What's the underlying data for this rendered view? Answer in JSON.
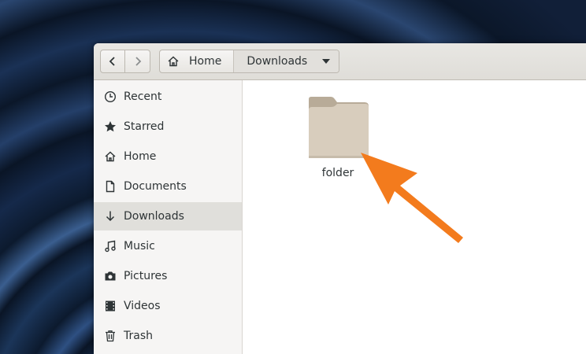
{
  "header": {
    "back_icon": "chevron-left-icon",
    "forward_icon": "chevron-right-icon",
    "path": [
      "Home",
      "Downloads"
    ],
    "dropdown_icon": "caret-down-icon"
  },
  "sidebar": {
    "items": [
      {
        "label": "Recent",
        "icon": "clock-icon"
      },
      {
        "label": "Starred",
        "icon": "star-icon"
      },
      {
        "label": "Home",
        "icon": "home-icon"
      },
      {
        "label": "Documents",
        "icon": "document-icon"
      },
      {
        "label": "Downloads",
        "icon": "download-icon",
        "selected": true
      },
      {
        "label": "Music",
        "icon": "music-icon"
      },
      {
        "label": "Pictures",
        "icon": "camera-icon"
      },
      {
        "label": "Videos",
        "icon": "film-icon"
      },
      {
        "label": "Trash",
        "icon": "trash-icon"
      }
    ]
  },
  "content": {
    "items": [
      {
        "name": "folder",
        "icon": "folder-icon"
      }
    ]
  },
  "annotation": {
    "arrow_color": "#f37b1d",
    "icon": "arrow-annotation-icon"
  },
  "colors": {
    "selected_bg": "#e0dfdb",
    "folder_body": "#d8cdbd",
    "folder_tab": "#b8ab98",
    "text": "#2e3436"
  }
}
